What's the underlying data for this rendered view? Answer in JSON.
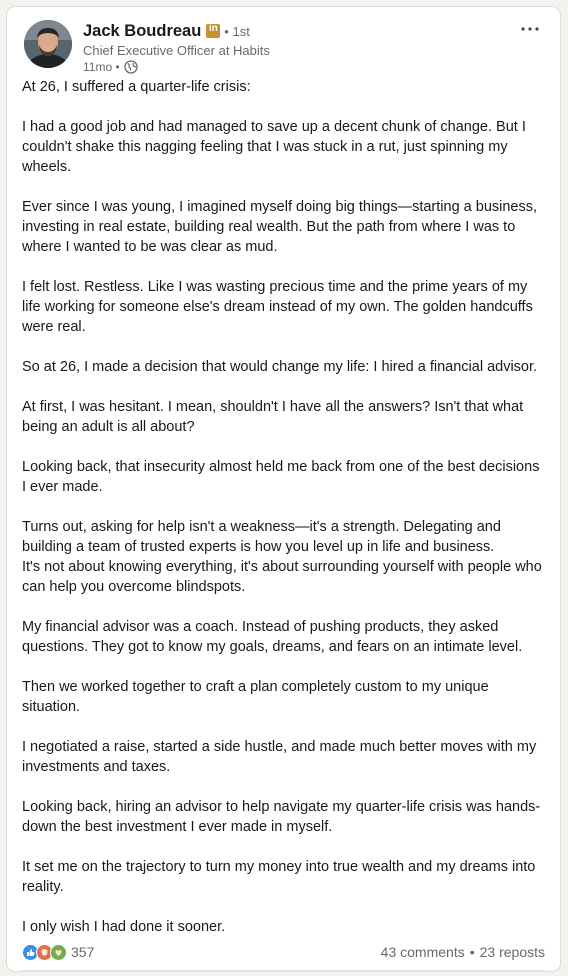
{
  "author": {
    "name": "Jack Boudreau",
    "badge": "in",
    "degree": "• 1st",
    "headline": "Chief Executive Officer at Habits",
    "time": "11mo •"
  },
  "icons": {
    "more": "more-options-icon",
    "visibility": "globe-icon",
    "badge": "linkedin-premium-icon"
  },
  "colors": {
    "badge": "#c4932b",
    "like": "#378fe9",
    "celebrate": "#df704d",
    "support": "#6dae4f"
  },
  "post": {
    "paragraphs": [
      "At 26, I suffered a quarter-life crisis:",
      "I had a good job and had managed to save up a decent chunk of change. But I couldn't shake this nagging feeling that I was stuck in a rut, just spinning my wheels.",
      "Ever since I was young, I imagined myself doing big things—starting a business, investing in real estate, building real wealth. But the path from where I was to where I wanted to be was clear as mud.",
      "I felt lost. Restless. Like I was wasting precious time and the prime years of my life working for someone else's dream instead of my own. The golden handcuffs were real.",
      "So at 26, I made a decision that would change my life: I hired a financial advisor.",
      "At first, I was hesitant. I mean, shouldn't I have all the answers? Isn't that what being an adult is all about?",
      "Looking back, that insecurity almost held me back from one of the best decisions I ever made.",
      "Turns out, asking for help isn't a weakness—it's a strength. Delegating and building a team of trusted experts is how you level up in life and business.\nIt's not about knowing everything, it's about surrounding yourself with people who can help you overcome blindspots.",
      "My financial advisor was a coach. Instead of pushing products, they asked questions. They got to know my goals, dreams, and fears on an intimate level.",
      "Then we worked together to craft a plan completely custom to my unique situation.",
      "I negotiated a raise, started a side hustle, and made much better moves with my investments and taxes.",
      "Looking back, hiring an advisor to help navigate my quarter-life crisis was hands-down the best investment I ever made in myself.",
      "It set me on the trajectory to turn my money into true wealth and my dreams into reality.",
      "I only wish I had done it sooner."
    ]
  },
  "social": {
    "reaction_count": "357",
    "comments": "43 comments",
    "separator": "•",
    "reposts": "23 reposts"
  }
}
